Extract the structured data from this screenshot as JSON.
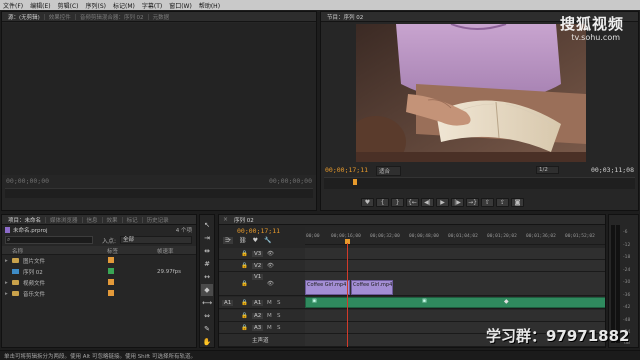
{
  "menu": [
    "文件(F)",
    "编辑(E)",
    "剪辑(C)",
    "序列(S)",
    "标记(M)",
    "字幕(T)",
    "窗口(W)",
    "帮助(H)"
  ],
  "source_panel": {
    "tabs": [
      "源：(无剪辑)",
      "效果控件",
      "音频剪辑混合器：序列 02",
      "元数据"
    ],
    "timecode_left": "00;00;00;00",
    "timecode_right": "00;00;00;00"
  },
  "program_panel": {
    "tab": "节目：序列 02",
    "timecode_left": "00;00;17;11",
    "fit_label": "适合",
    "resolution": "1/2",
    "timecode_right": "00;03;11;08"
  },
  "project_panel": {
    "tabs": [
      "项目：未命名",
      "媒体浏览器",
      "信息",
      "效果",
      "标记",
      "历史记录"
    ],
    "file_name": "未命名.prproj",
    "item_count": "4 个项",
    "search_placeholder": "",
    "in_label": "入点:",
    "in_value": "全部",
    "col_name": "名称",
    "col_label": "标签",
    "col_fps": "帧速率",
    "items": [
      {
        "name": "图片文件",
        "type": "folder",
        "color": "#e39a3a",
        "fps": ""
      },
      {
        "name": "序列 02",
        "type": "sequence",
        "color": "#3aa655",
        "fps": "29.97fps"
      },
      {
        "name": "视频文件",
        "type": "folder",
        "color": "#e39a3a",
        "fps": ""
      },
      {
        "name": "音乐文件",
        "type": "folder",
        "color": "#e39a3a",
        "fps": ""
      }
    ]
  },
  "timeline": {
    "tab": "序列 02",
    "timecode": "00;00;17;11",
    "ruler": [
      "00;00",
      "00;00;16;00",
      "00;00;32;00",
      "00;00;48;00",
      "00;01;04;02",
      "00;01;20;02",
      "00;01;36;02",
      "00;01;52;02"
    ],
    "tracks": [
      {
        "id": "V3",
        "kind": "video"
      },
      {
        "id": "V2",
        "kind": "video"
      },
      {
        "id": "V1",
        "kind": "video"
      },
      {
        "id": "A1",
        "kind": "audio"
      },
      {
        "id": "A2",
        "kind": "audio"
      },
      {
        "id": "A3",
        "kind": "audio"
      }
    ],
    "master_label": "主声道",
    "clips": [
      {
        "name": "Coffee Girl.mp4"
      },
      {
        "name": "Coffee Girl.mp4"
      }
    ]
  },
  "meter_scale": [
    "-6",
    "-12",
    "-18",
    "-24",
    "-30",
    "-36",
    "-42",
    "-48",
    "-54"
  ],
  "meter_db_label": "dB",
  "status_text": "单击可将剪辑拆分为两段。使用 Alt 可忽略链接。使用 Shift 可选择所有轨道。",
  "watermarks": {
    "sohu": "搜狐视频",
    "url": "tv.sohu.com",
    "group": "学习群：97971882"
  },
  "colors": {
    "accent_orange": "#e79a2c",
    "clip_video": "#9f8ad6",
    "clip_audio": "#2f8a5e",
    "playhead": "#d23a2a"
  }
}
